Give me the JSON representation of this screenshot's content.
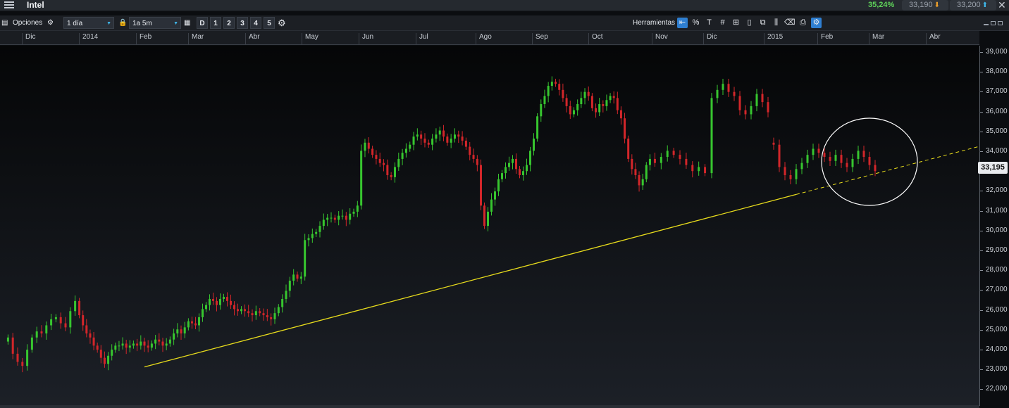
{
  "header": {
    "title": "Intel",
    "change_pct": "35,24%",
    "sell_price": "33,190",
    "buy_price": "33,200"
  },
  "toolbar": {
    "options_label": "Opciones",
    "interval": "1 día",
    "range": "1a 5m",
    "buttons": [
      "D",
      "1",
      "2",
      "3",
      "4",
      "5"
    ],
    "tools_label": "Herramientas"
  },
  "time_axis": {
    "months": [
      "Dic",
      "2014",
      "Feb",
      "Mar",
      "Abr",
      "May",
      "Jun",
      "Jul",
      "Ago",
      "Sep",
      "Oct",
      "Nov",
      "Dic",
      "2015",
      "Feb",
      "Mar",
      "Abr"
    ]
  },
  "price_axis": {
    "ticks": [
      "39,000",
      "38,000",
      "37,000",
      "36,000",
      "35,000",
      "34,000",
      "33,000",
      "32,000",
      "31,000",
      "30,000",
      "29,000",
      "28,000",
      "27,000",
      "26,000",
      "25,000",
      "24,000",
      "23,000",
      "22,000"
    ],
    "current": "33,195"
  },
  "colors": {
    "up": "#37c62f",
    "down": "#d3262a",
    "trendline": "#e8dc1c",
    "highlight_circle": "#ffffff"
  },
  "chart_data": {
    "type": "candlestick",
    "ylim": [
      21.5,
      39.2
    ],
    "closes_by_month": [
      {
        "month": "Dic 2013",
        "values": [
          25.0,
          24.2,
          23.8,
          23.6,
          24.4,
          25.0,
          25.3,
          25.2,
          25.6,
          25.9,
          26.0,
          25.7,
          25.5,
          26.3,
          26.8
        ]
      },
      {
        "month": "Ene 2014",
        "values": [
          26.1,
          25.6,
          25.2,
          25.0,
          24.6,
          24.4,
          24.0,
          23.7,
          24.1,
          24.4,
          24.6,
          24.6,
          24.7,
          24.5,
          24.6,
          24.7
        ]
      },
      {
        "month": "Feb 2014",
        "values": [
          24.6,
          24.8,
          24.6,
          24.5,
          24.7,
          24.9,
          24.8,
          24.6,
          24.7,
          24.9,
          25.2,
          25.4,
          25.2,
          25.5,
          25.8
        ]
      },
      {
        "month": "Mar 2014",
        "values": [
          25.7,
          25.6,
          26.0,
          26.4,
          26.6,
          26.9,
          26.8,
          26.6,
          26.9,
          27.0,
          26.8,
          26.6,
          26.4,
          26.3,
          26.4,
          26.3
        ]
      },
      {
        "month": "Abr 2014",
        "values": [
          26.2,
          26.1,
          26.3,
          26.2,
          26.1,
          26.0,
          25.9,
          26.2,
          26.5,
          26.9,
          27.3,
          27.8,
          28.1,
          27.9,
          28.0
        ]
      },
      {
        "month": "May 2014",
        "values": [
          29.8,
          29.9,
          30.1,
          30.2,
          30.5,
          30.8,
          30.9,
          30.9,
          30.8,
          31.0,
          31.0,
          30.8,
          31.1,
          31.2,
          31.5
        ]
      },
      {
        "month": "Jun 2014",
        "values": [
          34.2,
          34.6,
          34.3,
          34.0,
          33.8,
          33.6,
          33.5,
          33.0,
          32.9,
          33.4,
          33.8,
          34.1,
          34.3,
          34.5,
          34.9,
          35.0
        ]
      },
      {
        "month": "Jul 2014",
        "values": [
          34.8,
          34.6,
          34.5,
          34.8,
          35.0,
          35.2,
          34.9,
          34.6,
          34.8,
          35.0,
          34.9,
          34.7,
          34.4,
          34.0,
          33.8,
          33.5
        ]
      },
      {
        "month": "Ago 2014",
        "values": [
          31.5,
          30.5,
          31.2,
          31.8,
          32.2,
          32.8,
          33.1,
          33.4,
          33.6,
          33.8,
          33.3,
          33.0,
          33.2,
          33.5,
          34.2,
          34.8
        ]
      },
      {
        "month": "Sep 2014",
        "values": [
          35.9,
          36.5,
          36.9,
          37.4,
          37.6,
          37.5,
          37.2,
          36.8,
          36.4,
          36.0,
          36.2,
          36.5,
          36.8,
          37.1,
          36.9,
          36.3
        ]
      },
      {
        "month": "Oct 2014",
        "values": [
          36.1,
          36.5,
          36.4,
          36.7,
          36.9,
          36.8,
          36.2,
          35.8,
          34.8,
          33.8,
          33.3,
          33.0,
          32.5,
          32.8,
          33.5,
          33.8
        ]
      },
      {
        "month": "Nov 2014",
        "values": [
          33.6,
          33.9,
          34.2,
          34.0,
          33.8,
          33.5,
          33.2,
          33.4,
          33.1
        ]
      }
    ]
  }
}
